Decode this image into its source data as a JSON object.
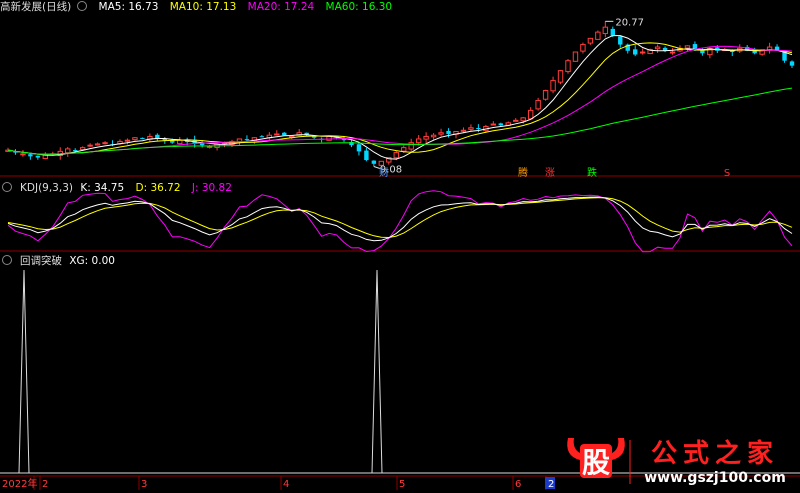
{
  "panel1": {
    "title": "高新发展(日线)",
    "ma": [
      {
        "label": "MA5: 16.73",
        "color": "#ffffff"
      },
      {
        "label": "MA10: 17.13",
        "color": "#ffff00"
      },
      {
        "label": "MA20: 17.24",
        "color": "#ff00ff"
      },
      {
        "label": "MA60: 16.30",
        "color": "#00ff00"
      }
    ],
    "high_label": "20.77",
    "low_label": "9.08",
    "markers": [
      {
        "text": "财",
        "color": "#5a9cff"
      },
      {
        "text": "腾",
        "color": "#ff9900"
      },
      {
        "text": "涨",
        "color": "#ff3030"
      },
      {
        "text": "跌",
        "color": "#00ff00"
      },
      {
        "text": "S",
        "color": "#ff3030"
      }
    ]
  },
  "panel2": {
    "title": "KDJ(9,3,3)",
    "k_label": "K: 34.75",
    "d_label": "D: 36.72",
    "j_label": "J: 30.82",
    "k_color": "#ffffff",
    "d_color": "#ffff00",
    "j_color": "#ff00ff"
  },
  "panel3": {
    "title": "回调突破",
    "xg_label": "XG: 0.00"
  },
  "xaxis": {
    "labels": [
      "2022年",
      "2",
      "3",
      "4",
      "5",
      "6",
      "2"
    ]
  },
  "watermark": {
    "logo_char": "股",
    "text": "公式之家",
    "url": "www.gszj100.com"
  },
  "chart_data": [
    {
      "type": "line",
      "title": "高新发展(日线)",
      "annotations": [
        "20.77",
        "9.08"
      ],
      "series": [
        {
          "name": "MA5",
          "last": 16.73
        },
        {
          "name": "MA10",
          "last": 17.13
        },
        {
          "name": "MA20",
          "last": 17.24
        },
        {
          "name": "MA60",
          "last": 16.3
        }
      ],
      "max_price": 20.77,
      "min_price": 9.08,
      "close": [
        10.4,
        10.2,
        10.1,
        9.9,
        9.8,
        10.0,
        10.1,
        10.3,
        10.5,
        10.4,
        10.6,
        10.8,
        10.9,
        11.0,
        10.8,
        11.1,
        11.2,
        11.4,
        11.3,
        11.5,
        11.3,
        11.2,
        11.0,
        11.2,
        11.1,
        10.9,
        10.8,
        10.7,
        10.9,
        11.0,
        11.1,
        11.3,
        11.2,
        11.4,
        11.5,
        11.6,
        11.7,
        11.6,
        11.5,
        11.8,
        11.6,
        11.4,
        11.3,
        11.5,
        11.4,
        11.2,
        10.8,
        10.3,
        9.6,
        9.3,
        9.5,
        9.8,
        10.2,
        10.6,
        11.0,
        11.3,
        11.5,
        11.6,
        11.8,
        11.7,
        11.9,
        12.0,
        12.2,
        12.1,
        12.3,
        12.5,
        12.4,
        12.6,
        12.8,
        13.0,
        13.6,
        14.4,
        15.2,
        16.0,
        16.8,
        17.6,
        18.3,
        18.9,
        19.4,
        19.9,
        20.3,
        19.6,
        18.9,
        18.4,
        18.1,
        18.3,
        18.5,
        18.7,
        18.4,
        18.3,
        18.6,
        18.8,
        18.5,
        18.2,
        18.6,
        18.4,
        18.5,
        18.3,
        18.6,
        18.4,
        18.2,
        18.5,
        18.7,
        18.4,
        17.6,
        17.2
      ]
    },
    {
      "type": "line",
      "title": "KDJ(9,3,3)",
      "series": [
        {
          "name": "K",
          "last": 34.75
        },
        {
          "name": "D",
          "last": 36.72
        },
        {
          "name": "J",
          "last": 30.82
        }
      ]
    },
    {
      "type": "line",
      "title": "回调突破",
      "series": [
        {
          "name": "XG",
          "last": 0.0,
          "signals": 2
        }
      ]
    }
  ]
}
